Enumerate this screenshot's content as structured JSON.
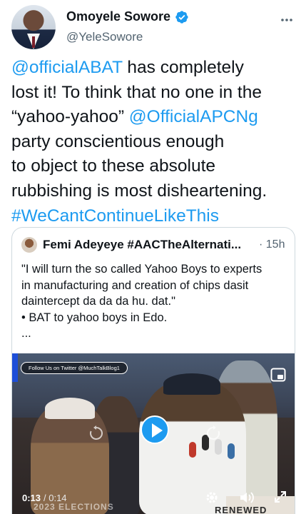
{
  "author": {
    "display_name": "Omoyele Sowore",
    "handle": "@YeleSowore"
  },
  "tweet": {
    "lines": [
      [
        {
          "text": "@officialABAT",
          "link": true
        },
        {
          "text": " has completely",
          "link": false
        }
      ],
      [
        {
          "text": "lost it! To think that no one in the",
          "link": false
        }
      ],
      [
        {
          "text": "“yahoo-yahoo” ",
          "link": false
        },
        {
          "text": "@OfficialAPCNg",
          "link": true
        }
      ],
      [
        {
          "text": "party conscientious enough",
          "link": false
        }
      ],
      [
        {
          "text": "to object to these absolute",
          "link": false
        }
      ],
      [
        {
          "text": "rubbishing is most disheartening.",
          "link": false
        }
      ],
      [
        {
          "text": "#WeCantContinueLikeThis",
          "link": true
        }
      ]
    ]
  },
  "quote": {
    "author_name": "Femi Adeyeye #AACTheAlternati...",
    "time": "· 15h",
    "lines": [
      "\"I will turn the so called Yahoo Boys to experts",
      "in manufacturing and creation of chips dasit",
      "daintercept da da da hu. dat.\"",
      "• BAT to yahoo boys in Edo.",
      "..."
    ]
  },
  "video": {
    "overlay_tag": "Follow Us on Twitter @MuchTalkBlog1",
    "current_time": "0:13",
    "duration_text": "/ 0:14",
    "watermark_left": "2023 ELECTIONS",
    "watermark_right": "RENEWED"
  },
  "colors": {
    "link": "#1d9bf0",
    "text": "#0f1419",
    "muted": "#536471",
    "border": "#cfd9de",
    "play_button": "#1d9bf0"
  },
  "icons": {
    "verified": "verified-badge-icon",
    "more": "more-options-icon",
    "play": "play-icon",
    "pip": "picture-in-picture-icon",
    "settings": "gear-icon",
    "volume": "volume-icon",
    "expand": "expand-icon"
  }
}
